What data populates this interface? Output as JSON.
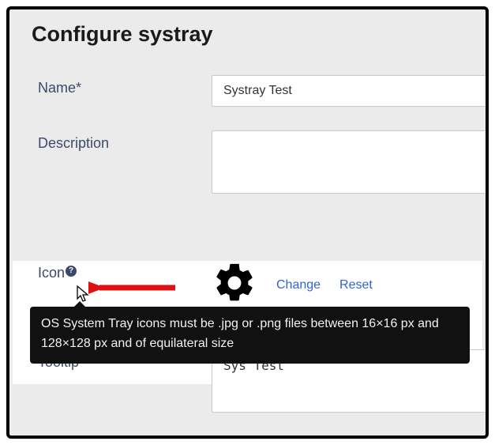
{
  "title": "Configure systray",
  "labels": {
    "name": "Name",
    "name_required_mark": "*",
    "description": "Description",
    "icon": "Icon",
    "tooltip": "Tooltip"
  },
  "fields": {
    "name_value": "Systray Test",
    "description_value": "",
    "tooltip_value": "Sys Test"
  },
  "icon_row": {
    "change": "Change",
    "reset": "Reset",
    "help_symbol": "?"
  },
  "help_tooltip": "OS System Tray icons must be .jpg or .png files between 16×16 px and 128×128 px and of equilateral size"
}
